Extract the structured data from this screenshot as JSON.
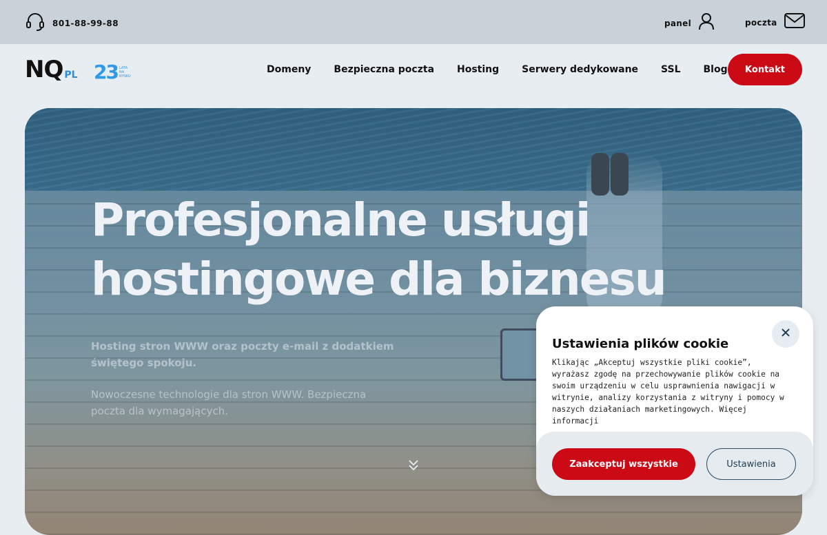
{
  "topbar": {
    "phone": "801-88-99-88",
    "panel_label": "panel",
    "mail_label": "poczta"
  },
  "logo": {
    "brand": "NQ",
    "suffix": "PL",
    "years": "23",
    "years_caption": "LATA NA RYNKU"
  },
  "nav": {
    "items": [
      "Domeny",
      "Bezpieczna poczta",
      "Hosting",
      "Serwery dedykowane",
      "SSL",
      "Blog"
    ],
    "contact": "Kontakt"
  },
  "hero": {
    "title_line1": "Profesjonalne usługi",
    "title_line2": "hostingowe dla biznesu",
    "subtitle1": "Hosting stron WWW oraz poczty e-mail z dodatkiem świętego spokoju.",
    "subtitle2": "Nowoczesne technologie dla stron WWW. Bezpieczna poczta dla wymagających."
  },
  "cookie": {
    "title": "Ustawienia plików cookie",
    "body": "Klikając „Akceptuj wszystkie pliki cookie”, wyrażasz zgodę na przechowywanie plików cookie na swoim urządzeniu w celu usprawnienia nawigacji w witrynie, analizy korzystania z witryny i pomocy w naszych działaniach marketingowych. Więcej informacji",
    "accept": "Zaakceptuj wszystkie",
    "settings": "Ustawienia"
  },
  "colors": {
    "accent": "#cc0a16",
    "brand_blue": "#2f8ee0",
    "topbar": "#c9d2d9",
    "page_bg": "#e8edf2"
  },
  "icons": [
    "headset-icon",
    "user-icon",
    "mail-icon",
    "close-icon",
    "double-chevron-down-icon"
  ]
}
